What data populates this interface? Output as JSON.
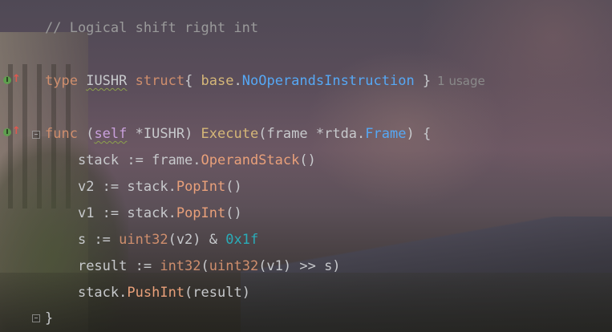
{
  "editor": {
    "language": "Go",
    "colors": {
      "keyword": "#cf8e6d",
      "function": "#56a8f5",
      "member": "#c77dbb",
      "number": "#2aacb8",
      "comment": "#9a9a9a",
      "text": "#c7c9cc",
      "usage_hint": "#8a8a8a"
    },
    "gutter": {
      "implementation_icon_1": "implemented-method-icon",
      "implementation_icon_2": "implemented-method-icon",
      "fold_icon": "fold-icon"
    },
    "lines": {
      "comment": "// Logical shift right int",
      "type_decl": {
        "kw_type": "type",
        "name": "IUSHR",
        "kw_struct": "struct",
        "brace_open": "{ ",
        "pkg": "base",
        "dot": ".",
        "embedded": "NoOperandsInstruction",
        "brace_close": " }",
        "usage_hint": "1 usage"
      },
      "func_decl": {
        "kw_func": "func",
        "paren_open": " (",
        "receiver": "self",
        "ptr": " *",
        "receiver_type": "IUSHR",
        "paren_close": ") ",
        "method": "Execute",
        "params_open": "(frame *",
        "pkg": "rtda",
        "dot": ".",
        "param_type": "Frame",
        "params_close": ") {"
      },
      "l1": {
        "indent": "    ",
        "var": "stack",
        "op": " := ",
        "obj": "frame",
        "dot": ".",
        "call": "OperandStack",
        "args": "()"
      },
      "l2": {
        "indent": "    ",
        "var": "v2",
        "op": " := ",
        "obj": "stack",
        "dot": ".",
        "call": "PopInt",
        "args": "()"
      },
      "l3": {
        "indent": "    ",
        "var": "v1",
        "op": " := ",
        "obj": "stack",
        "dot": ".",
        "call": "PopInt",
        "args": "()"
      },
      "l4": {
        "indent": "    ",
        "var": "s",
        "op": " := ",
        "conv": "uint32",
        "arg": "(v2)",
        "and": " & ",
        "num": "0x1f"
      },
      "l5": {
        "indent": "    ",
        "var": "result",
        "op": " := ",
        "conv1": "int32",
        "p1": "(",
        "conv2": "uint32",
        "rest": "(v1) >> s)"
      },
      "l6": {
        "indent": "    ",
        "obj": "stack",
        "dot": ".",
        "call": "PushInt",
        "args": "(result)"
      },
      "closing": "}"
    }
  }
}
